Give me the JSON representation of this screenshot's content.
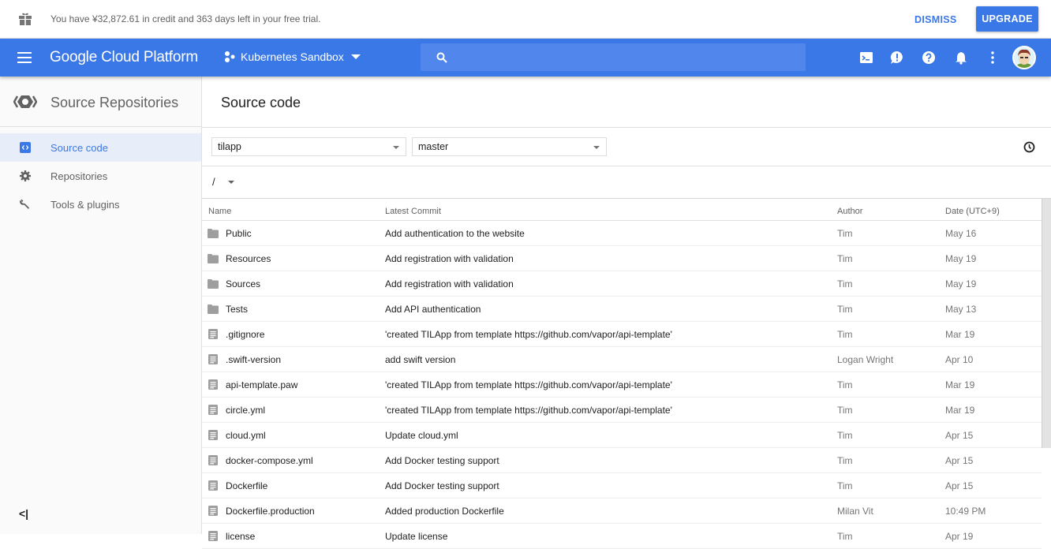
{
  "banner": {
    "message": "You have ¥32,872.61 in credit and 363 days left in your free trial.",
    "dismiss_label": "DISMISS",
    "upgrade_label": "UPGRADE",
    "icon": "gift-icon"
  },
  "topbar": {
    "logo": "Google Cloud Platform",
    "project": "Kubernetes Sandbox",
    "search_placeholder": "",
    "icons": [
      "cloud-shell-icon",
      "feedback-icon",
      "help-icon",
      "notifications-icon",
      "more-vert-icon",
      "avatar"
    ],
    "accent": "#3b78e7"
  },
  "sidebar": {
    "product_title": "Source Repositories",
    "items": [
      {
        "label": "Source code",
        "icon": "code-icon",
        "active": true
      },
      {
        "label": "Repositories",
        "icon": "gear-icon",
        "active": false
      },
      {
        "label": "Tools & plugins",
        "icon": "wrench-icon",
        "active": false
      }
    ],
    "collapse_label": "<|"
  },
  "main": {
    "title": "Source code",
    "repo_select": "tilapp",
    "branch_select": "master",
    "path": "/",
    "columns": [
      "Name",
      "Latest Commit",
      "Author",
      "Date (UTC+9)"
    ],
    "rows": [
      {
        "type": "folder",
        "name": "Public",
        "commit": "Add authentication to the website",
        "author": "Tim",
        "date": "May 16"
      },
      {
        "type": "folder",
        "name": "Resources",
        "commit": "Add registration with validation",
        "author": "Tim",
        "date": "May 19"
      },
      {
        "type": "folder",
        "name": "Sources",
        "commit": "Add registration with validation",
        "author": "Tim",
        "date": "May 19"
      },
      {
        "type": "folder",
        "name": "Tests",
        "commit": "Add API authentication",
        "author": "Tim",
        "date": "May 13"
      },
      {
        "type": "file",
        "name": ".gitignore",
        "commit": "'created TILApp from template https://github.com/vapor/api-template'",
        "author": "Tim",
        "date": "Mar 19"
      },
      {
        "type": "file",
        "name": ".swift-version",
        "commit": "add swift version",
        "author": "Logan Wright",
        "date": "Apr 10"
      },
      {
        "type": "file",
        "name": "api-template.paw",
        "commit": "'created TILApp from template https://github.com/vapor/api-template'",
        "author": "Tim",
        "date": "Mar 19"
      },
      {
        "type": "file",
        "name": "circle.yml",
        "commit": "'created TILApp from template https://github.com/vapor/api-template'",
        "author": "Tim",
        "date": "Mar 19"
      },
      {
        "type": "file",
        "name": "cloud.yml",
        "commit": "Update cloud.yml",
        "author": "Tim",
        "date": "Apr 15"
      },
      {
        "type": "file",
        "name": "docker-compose.yml",
        "commit": "Add Docker testing support",
        "author": "Tim",
        "date": "Apr 15"
      },
      {
        "type": "file",
        "name": "Dockerfile",
        "commit": "Add Docker testing support",
        "author": "Tim",
        "date": "Apr 15"
      },
      {
        "type": "file",
        "name": "Dockerfile.production",
        "commit": "Added production Dockerfile",
        "author": "Milan Vit",
        "date": "10:49 PM"
      },
      {
        "type": "file",
        "name": "license",
        "commit": "Update license",
        "author": "Tim",
        "date": "Apr 19"
      }
    ]
  }
}
